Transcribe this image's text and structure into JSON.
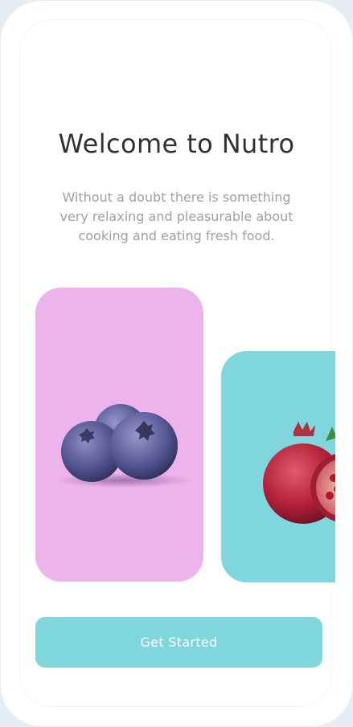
{
  "welcome": {
    "title": "Welcome to Nutro",
    "description": "Without a doubt there is something very relaxing and pleasurable about cooking and eating fresh food."
  },
  "cards": [
    {
      "fruit": "blueberry-image",
      "color": "#ecb3ec"
    },
    {
      "fruit": "pomegranate-image",
      "color": "#7fd6dd"
    }
  ],
  "actions": {
    "get_started": "Get Started",
    "accent_color": "#7fd6dd"
  }
}
